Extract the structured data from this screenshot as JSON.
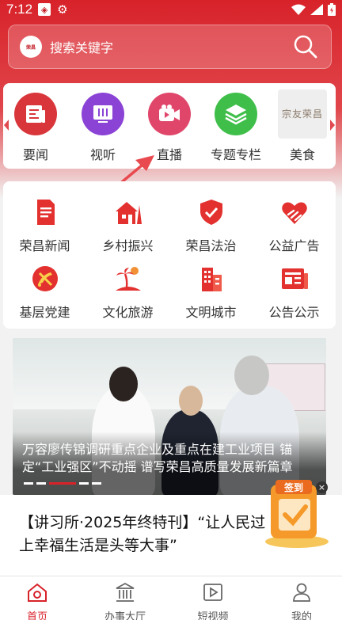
{
  "status_bar": {
    "time": "7:12"
  },
  "search": {
    "logo_text": "荣昌",
    "placeholder": "搜索关键字"
  },
  "channels": [
    {
      "label": "要闻",
      "icon": "news-icon",
      "color": "#d9363b"
    },
    {
      "label": "视听",
      "icon": "tv-icon",
      "color": "#8b43d6"
    },
    {
      "label": "直播",
      "icon": "live-camera-icon",
      "color": "#e0466a"
    },
    {
      "label": "专题专栏",
      "icon": "layers-icon",
      "color": "#3fbf4a"
    },
    {
      "label": "美食",
      "icon": "food-image-icon",
      "thumb_text": "宗友荣昌"
    }
  ],
  "services": [
    {
      "label": "荣昌新闻",
      "icon": "document-icon"
    },
    {
      "label": "乡村振兴",
      "icon": "rural-house-icon"
    },
    {
      "label": "荣昌法治",
      "icon": "shield-icon"
    },
    {
      "label": "公益广告",
      "icon": "heart-hands-icon"
    },
    {
      "label": "基层党建",
      "icon": "party-emblem-icon"
    },
    {
      "label": "文化旅游",
      "icon": "palm-island-icon"
    },
    {
      "label": "文明城市",
      "icon": "city-buildings-icon"
    },
    {
      "label": "公告公示",
      "icon": "newspaper-icon"
    }
  ],
  "banner": {
    "caption": "万容廖传锦调研重点企业及重点在建工业项目 锚定“工业强区”不动摇 谱写荣昌高质量发展新篇章"
  },
  "headline": "【讲习所·2025年终特刊】“让人民过上幸福生活是头等大事”",
  "checkin": {
    "label": "签到"
  },
  "bottom_nav": [
    {
      "label": "首页",
      "icon": "home-icon",
      "active": true
    },
    {
      "label": "办事大厅",
      "icon": "government-hall-icon",
      "active": false
    },
    {
      "label": "短视频",
      "icon": "video-play-icon",
      "active": false
    },
    {
      "label": "我的",
      "icon": "user-icon",
      "active": false
    }
  ],
  "colors": {
    "brand_red": "#d8222a",
    "accent_pink": "#e04a50"
  }
}
